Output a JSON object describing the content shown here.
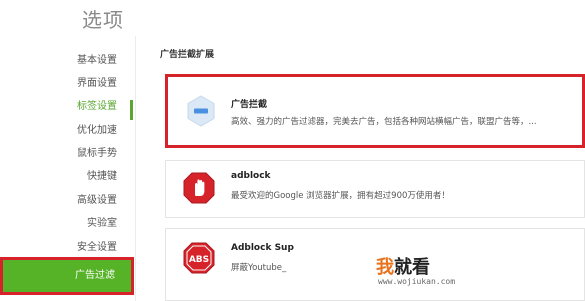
{
  "header": {
    "title": "选项"
  },
  "sidebar": {
    "items": [
      {
        "label": "基本设置"
      },
      {
        "label": "界面设置"
      },
      {
        "label": "标签设置"
      },
      {
        "label": "优化加速"
      },
      {
        "label": "鼠标手势"
      },
      {
        "label": "快捷键"
      },
      {
        "label": "高级设置"
      },
      {
        "label": "实验室"
      },
      {
        "label": "安全设置"
      },
      {
        "label": "广告过滤"
      }
    ]
  },
  "main": {
    "section_heading": "广告拦截扩展",
    "extensions": [
      {
        "name": "广告拦截",
        "description": "高效、强力的广告过滤器，完美去广告，包括各种网站横幅广告，联盟广告等，...",
        "icon": "minus-shield-icon"
      },
      {
        "name": "adblock",
        "description": "最受欢迎的Google 浏览器扩展，拥有超过900万使用者！",
        "icon": "stop-hand-icon"
      },
      {
        "name": "Adblock Sup",
        "description": "屏蔽Youtube_",
        "icon": "abs-icon"
      }
    ]
  },
  "watermark": {
    "first_char": "我",
    "rest": "就看",
    "url": "www.wojiukan.com"
  },
  "colors": {
    "accent_green": "#5ba631",
    "active_bg_green": "#56b226",
    "highlight_red": "#d6232a",
    "icon_red": "#d6232a",
    "icon_blue": "#4a90e2"
  }
}
